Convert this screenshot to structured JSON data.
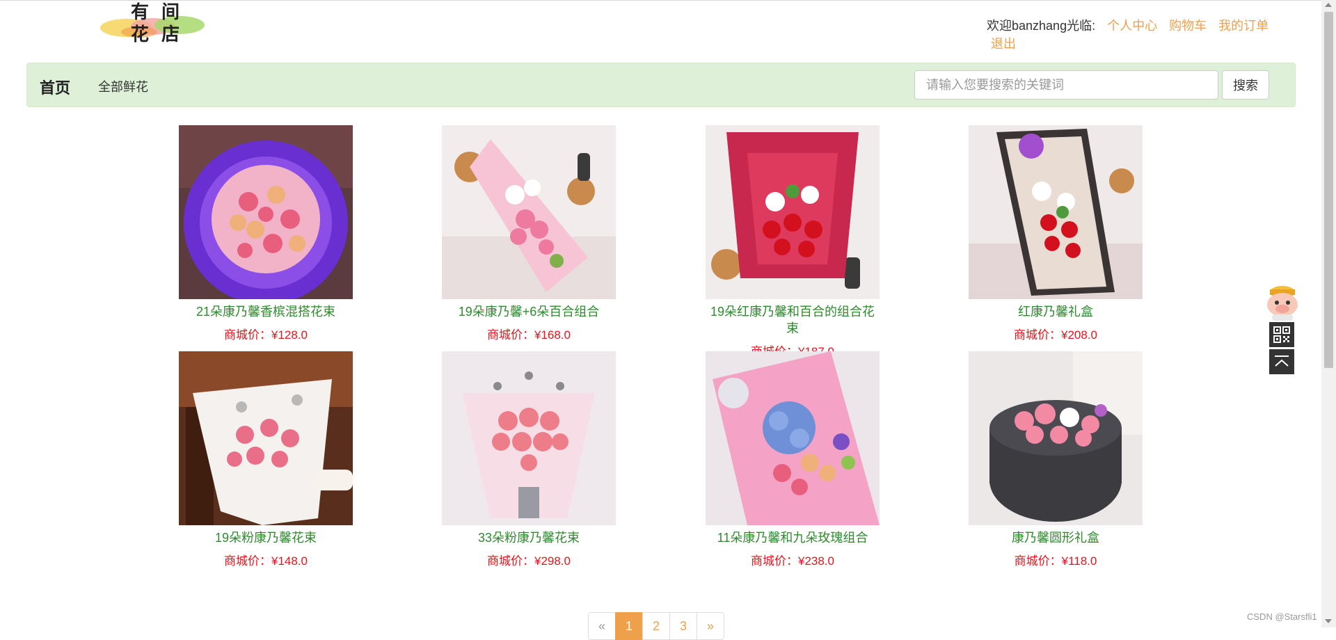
{
  "header": {
    "logo_text": "有间花店",
    "welcome": "欢迎banzhang光临:",
    "links": {
      "profile": "个人中心",
      "cart": "购物车",
      "orders": "我的订单",
      "logout": "退出"
    }
  },
  "nav": {
    "home": "首页",
    "all_flowers": "全部鲜花",
    "search_placeholder": "请输入您要搜索的关键词",
    "search_button": "搜索"
  },
  "products": [
    {
      "name": "21朵康乃馨香槟混搭花束",
      "price": "商城价：¥128.0",
      "image": "bouquet-purple-wrap"
    },
    {
      "name": "19朵康乃馨+6朵百合组合",
      "price": "商城价：¥168.0",
      "image": "bouquet-pink-lily"
    },
    {
      "name": "19朵红康乃馨和百合的组合花束",
      "price": "商城价：¥187.0",
      "image": "bouquet-red-lily"
    },
    {
      "name": "红康乃馨礼盒",
      "price": "商城价：¥208.0",
      "image": "gift-box-red"
    },
    {
      "name": "19朵粉康乃馨花束",
      "price": "商城价：¥148.0",
      "image": "bouquet-white-pink"
    },
    {
      "name": "33朵粉康乃馨花束",
      "price": "商城价：¥298.0",
      "image": "bouquet-pink-33"
    },
    {
      "name": "11朵康乃馨和九朵玫瑰组合",
      "price": "商城价：¥238.0",
      "image": "bouquet-hydrangea"
    },
    {
      "name": "康乃馨圆形礼盒",
      "price": "商城价：¥118.0",
      "image": "round-gift-box"
    }
  ],
  "pagination": {
    "prev": "«",
    "pages": [
      "1",
      "2",
      "3"
    ],
    "current": "1",
    "next": "»"
  },
  "side_widgets": [
    "mascot-icon",
    "qr-code-icon",
    "back-to-top-icon"
  ],
  "watermark": "CSDN @Starsfli1",
  "colors": {
    "accent": "#f0a04b",
    "navbar_bg": "#dff0d8",
    "product_name": "#2e8b2e",
    "price": "#e8141c"
  }
}
